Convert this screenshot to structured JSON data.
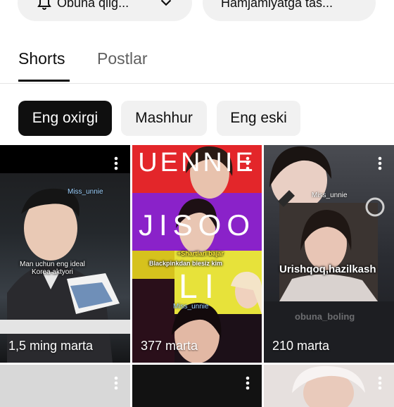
{
  "header": {
    "subscribe_label": "Obuna qilg...",
    "community_label": "Hamjamiyatga tas..."
  },
  "tabs": [
    {
      "label": "Shorts",
      "active": true
    },
    {
      "label": "Postlar",
      "active": false
    }
  ],
  "filters": [
    {
      "label": "Eng oxirgi",
      "selected": true
    },
    {
      "label": "Mashhur",
      "selected": false
    },
    {
      "label": "Eng eski",
      "selected": false
    }
  ],
  "shorts": [
    {
      "views": "1,5 ming marta",
      "overlay": "Man uchun eng ideal\nKorea aktyori",
      "watermark": "Miss_unnie"
    },
    {
      "views": "377 marta",
      "banner_top": "UENNIE",
      "banner_mid": "JISOO",
      "banner_bottom": "LI",
      "overlay_1": "+Shartlari bajar",
      "overlay_2": "Blackpinkdan biesiz kim",
      "watermark": "Miss_unnie"
    },
    {
      "views": "210 marta",
      "overlay": "Urishqoq,hazilkash",
      "watermark": "Miss_unnie",
      "faded": "obuna_boling"
    }
  ],
  "colors": {
    "accent": "#0f0f0f",
    "chip_bg": "#f1f1f1",
    "muted": "#606060"
  }
}
